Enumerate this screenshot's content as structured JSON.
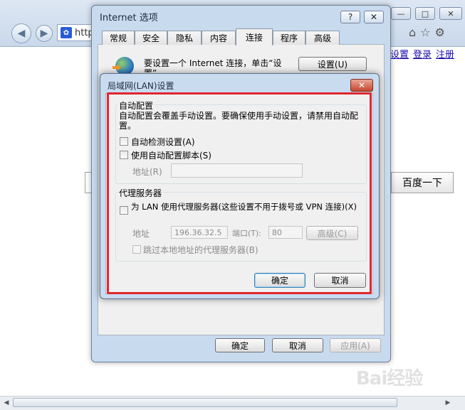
{
  "browser": {
    "address_prefix": "http",
    "links": [
      "设置",
      "登录",
      "注册"
    ],
    "search_button": "百度一下",
    "icons": [
      "back-icon",
      "forward-icon",
      "home-icon",
      "star-icon",
      "gear-icon"
    ],
    "watermark": "Bai经验"
  },
  "internet_options": {
    "title": "Internet 选项",
    "help_label": "?",
    "close_label": "✕",
    "tabs": [
      {
        "label": "常规"
      },
      {
        "label": "安全"
      },
      {
        "label": "隐私"
      },
      {
        "label": "内容"
      },
      {
        "label": "连接",
        "active": true
      },
      {
        "label": "程序"
      },
      {
        "label": "高级"
      }
    ],
    "setup_text": "要设置一个 Internet 连接，单击“设置”。",
    "setup_button": "设置(U)",
    "ok_button": "确定",
    "cancel_button": "取消",
    "apply_button": "应用(A)"
  },
  "lan": {
    "title": "局域网(LAN)设置",
    "close_label": "✕",
    "auto_config": {
      "label": "自动配置",
      "description": "自动配置会覆盖手动设置。要确保使用手动设置，请禁用自动配置。",
      "auto_detect": "自动检测设置(A)",
      "use_script": "使用自动配置脚本(S)",
      "address_label": "地址(R)",
      "address_value": ""
    },
    "proxy": {
      "label": "代理服务器",
      "use_proxy": "为 LAN 使用代理服务器(这些设置不用于拨号或 VPN 连接)(X)",
      "address_label": "地址",
      "address_value": "196.36.32.5",
      "port_label": "端口(T):",
      "port_value": "80",
      "advanced_button": "高级(C)",
      "bypass_local": "跳过本地地址的代理服务器(B)"
    },
    "ok_button": "确定",
    "cancel_button": "取消"
  },
  "colors": {
    "highlight_box": "#e0262e",
    "titlebar": "#c9dbef"
  }
}
